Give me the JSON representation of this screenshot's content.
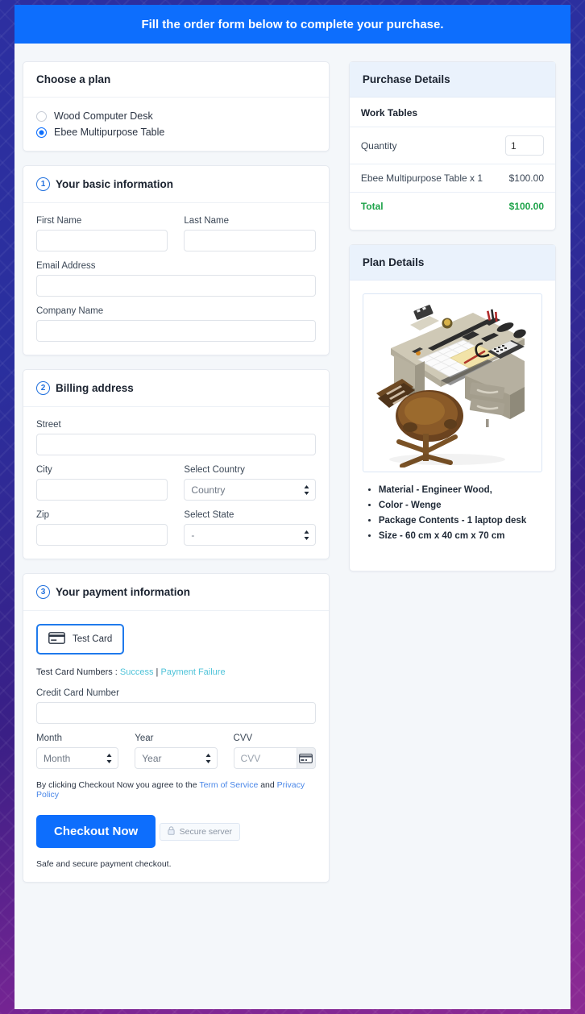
{
  "banner": {
    "text": "Fill the order form below to complete your purchase."
  },
  "plan_card": {
    "title": "Choose a plan",
    "options": [
      {
        "label": "Wood Computer Desk",
        "selected": false
      },
      {
        "label": "Ebee Multipurpose Table",
        "selected": true
      }
    ]
  },
  "basic_info": {
    "step": "1",
    "title": "Your basic information",
    "first_name_label": "First Name",
    "first_name_value": "",
    "last_name_label": "Last Name",
    "last_name_value": "",
    "email_label": "Email Address",
    "email_value": "",
    "company_label": "Company Name",
    "company_value": ""
  },
  "billing": {
    "step": "2",
    "title": "Billing address",
    "street_label": "Street",
    "street_value": "",
    "city_label": "City",
    "city_value": "",
    "country_label": "Select Country",
    "country_value": "Country",
    "zip_label": "Zip",
    "zip_value": "",
    "state_label": "Select State",
    "state_value": "-"
  },
  "payment": {
    "step": "3",
    "title": "Your payment information",
    "test_card_button": "Test  Card",
    "note_prefix": "Test Card Numbers : ",
    "note_success": "Success",
    "note_sep": " | ",
    "note_failure": "Payment Failure",
    "card_number_label": "Credit Card Number",
    "card_number_value": "",
    "month_label": "Month",
    "month_value": "Month",
    "year_label": "Year",
    "year_value": "Year",
    "cvv_label": "CVV",
    "cvv_placeholder": "CVV",
    "terms_prefix": "By clicking Checkout Now you agree to the ",
    "terms_service": "Term of Service",
    "terms_and": " and ",
    "terms_privacy": "Privacy Policy",
    "checkout_label": "Checkout Now",
    "secure_badge": "Secure server",
    "safe_note": "Safe and secure payment checkout."
  },
  "purchase_details": {
    "header": "Purchase Details",
    "group_title": "Work Tables",
    "quantity_label": "Quantity",
    "quantity_value": "1",
    "line_item_label": "Ebee Multipurpose Table x 1",
    "line_item_price": "$100.00",
    "total_label": "Total",
    "total_price": "$100.00"
  },
  "plan_details": {
    "header": "Plan Details",
    "image_alt": "office-desk-and-chair-photo",
    "bullets": [
      "Material - Engineer Wood,",
      "Color - Wenge",
      "Package Contents - 1 laptop desk",
      "Size - 60 cm x 40 cm x 70 cm"
    ]
  },
  "colors": {
    "accent": "#0d6efd",
    "total_green": "#1ea34a",
    "link_teal": "#4fc3d9",
    "link_blue": "#4a87e8"
  }
}
